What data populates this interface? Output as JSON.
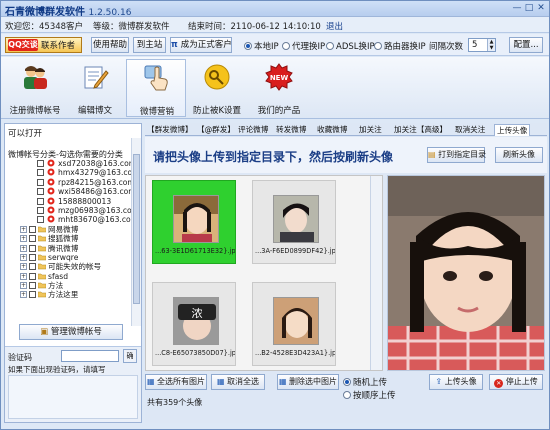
{
  "app": {
    "title": "石青微博群发软件",
    "version": "1.2.50.16",
    "win_min": "—",
    "win_max": "□",
    "win_close": "✕"
  },
  "info": {
    "welcome": "欢迎您：45348客户",
    "level": "等级：微博群发软件",
    "expire": "结束时间：2110-06-12 14:10:10",
    "logout": "退出"
  },
  "toolbar": {
    "qq_logo": "QQ交谈",
    "contact": "联系作者",
    "help": "使用帮助",
    "homepage": "到主站",
    "upgrade": "成为正式客户",
    "proxy_options": [
      {
        "label": "本地IP",
        "checked": true
      },
      {
        "label": "代理换IP",
        "checked": false
      },
      {
        "label": "ADSL换IP",
        "checked": false
      },
      {
        "label": "路由器换IP",
        "checked": false
      }
    ],
    "interval_label": "间隔次数",
    "interval_value": "5",
    "config": "配置..."
  },
  "ribbon": [
    {
      "label": "注册微博帐号",
      "icon": "users-icon"
    },
    {
      "label": "编辑博文",
      "icon": "edit-document-icon"
    },
    {
      "label": "微博营销",
      "icon": "hand-pointer-icon"
    },
    {
      "label": "防止被K设置",
      "icon": "key-shield-icon"
    },
    {
      "label": "我们的产品",
      "icon": "new-badge-icon",
      "badge": "NEW"
    }
  ],
  "left": {
    "title": "可以打开",
    "subtitle": "微博帐号分类-勾选你需要的分类",
    "accounts": [
      "xsd72038@163.com",
      "hmx43279@163.com",
      "rpz84215@163.com",
      "wxi58486@163.com",
      "15888800013",
      "mzg06983@163.com",
      "mht83670@163.com"
    ],
    "categories": [
      "网易微博",
      "搜狐微博",
      "腾讯微博",
      "serwqre",
      "可能失效的帐号",
      "sfasd",
      "方法",
      "方法这里"
    ],
    "manage_button": "管理微博帐号",
    "vcode_label": "验证码",
    "vcode_ok": "确",
    "vcode_hint": "如果下面出现验证码，请填写"
  },
  "tabs": [
    "【群发微博】",
    "【@群发】",
    "评论微博",
    "转发微博",
    "收藏微博",
    "加关注",
    "加关注【高级】",
    "取消关注",
    "上传头像"
  ],
  "main": {
    "banner": "请把头像上传到指定目录下，然后按刷新头像",
    "open_dir": "打到指定目录",
    "refresh": "刷新头像",
    "images": [
      {
        "caption": "...63-3E1D61713E32}.jpg",
        "selected": true
      },
      {
        "caption": "...3A-F6ED0899DF42}.jpg",
        "selected": false
      },
      {
        "caption": "...C8-E65073850D07}.jpg",
        "selected": false
      },
      {
        "caption": "...B2-4528E3D423A1}.jpg",
        "selected": false
      }
    ],
    "select_all": "全选所有图片",
    "deselect_all": "取消全选",
    "delete_selected": "删除选中图片",
    "upload_mode": [
      {
        "label": "随机上传",
        "checked": true
      },
      {
        "label": "按顺序上传",
        "checked": false
      }
    ],
    "upload_avatar": "上传头像",
    "stop_upload": "停止上传",
    "count_text": "共有359个头像"
  }
}
